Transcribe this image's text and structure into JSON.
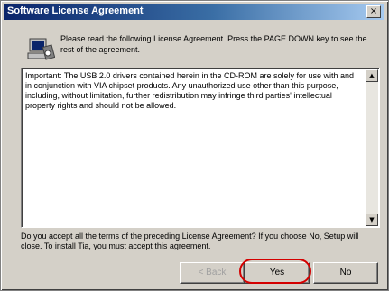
{
  "window": {
    "title": "Software License Agreement",
    "close_glyph": "×"
  },
  "instruction": "Please read the following License Agreement. Press the PAGE DOWN key to see the rest of the agreement.",
  "license": {
    "text": "Important: The USB 2.0 drivers contained herein in the CD-ROM are solely for use with and in conjunction with VIA chipset products. Any unauthorized use other than this purpose, including, without limitation, further redistribution may infringe third parties' intellectual property rights and should not be allowed."
  },
  "scrollbar": {
    "up_glyph": "▲",
    "down_glyph": "▼"
  },
  "question": "Do you accept all the terms of the preceding License Agreement? If you choose No, Setup will close. To install Tia, you must accept this agreement.",
  "buttons": {
    "back": "< Back",
    "yes": "Yes",
    "no": "No"
  },
  "icons": {
    "setup": "setup-computer-icon"
  }
}
